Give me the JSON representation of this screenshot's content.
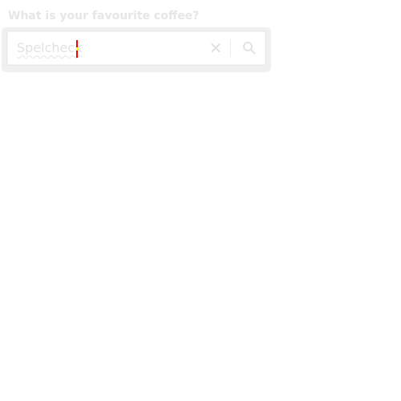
{
  "form": {
    "label": "What is your favourite coffee?",
    "input_value": "Spelcheck",
    "clear_icon": "close-icon",
    "search_icon": "search-icon"
  }
}
